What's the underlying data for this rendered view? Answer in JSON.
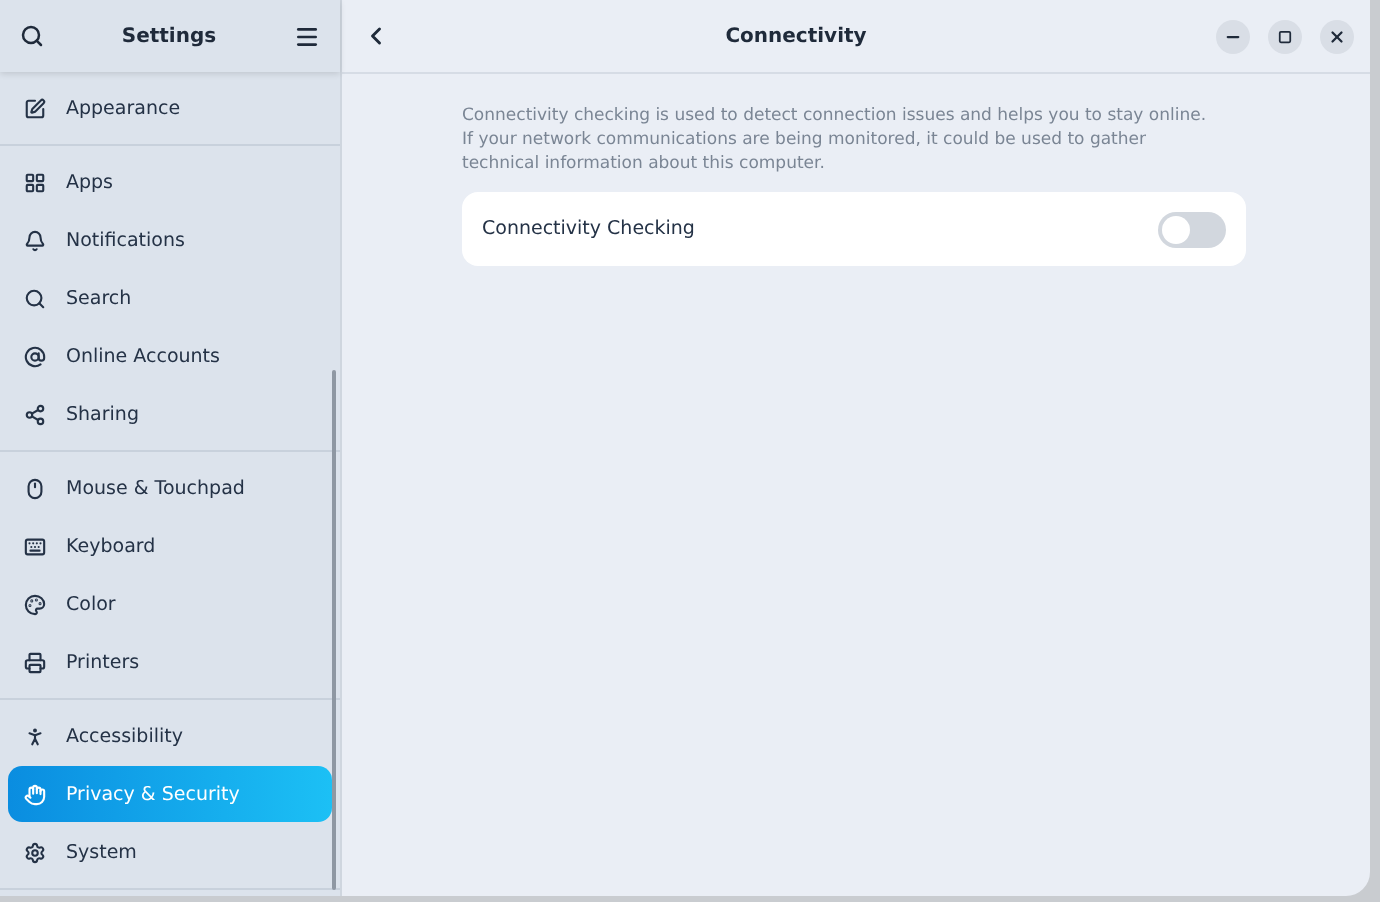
{
  "sidebar": {
    "title": "Settings",
    "groups": [
      {
        "items": [
          {
            "label": "Appearance",
            "selected": false
          }
        ]
      },
      {
        "items": [
          {
            "label": "Apps",
            "selected": false
          },
          {
            "label": "Notifications",
            "selected": false
          },
          {
            "label": "Search",
            "selected": false
          },
          {
            "label": "Online Accounts",
            "selected": false
          },
          {
            "label": "Sharing",
            "selected": false
          }
        ]
      },
      {
        "items": [
          {
            "label": "Mouse & Touchpad",
            "selected": false
          },
          {
            "label": "Keyboard",
            "selected": false
          },
          {
            "label": "Color",
            "selected": false
          },
          {
            "label": "Printers",
            "selected": false
          }
        ]
      },
      {
        "items": [
          {
            "label": "Accessibility",
            "selected": false
          },
          {
            "label": "Privacy & Security",
            "selected": true
          },
          {
            "label": "System",
            "selected": false
          }
        ]
      }
    ]
  },
  "page": {
    "title": "Connectivity",
    "description": "Connectivity checking is used to detect connection issues and helps you to stay online. If your network communications are being monitored, it could be used to gather technical information about this computer.",
    "settings": [
      {
        "label": "Connectivity Checking",
        "on": false
      }
    ]
  }
}
